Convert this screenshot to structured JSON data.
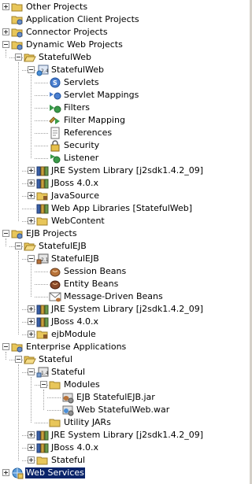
{
  "tree": {
    "items": [
      {
        "label": "Other Projects",
        "depth": 0,
        "icon": "folder-icon",
        "expander": "plus"
      },
      {
        "label": "Application Client Projects",
        "depth": 0,
        "icon": "project-folder-icon",
        "expander": "none"
      },
      {
        "label": "Connector Projects",
        "depth": 0,
        "icon": "project-folder-icon",
        "expander": "plus"
      },
      {
        "label": "Dynamic Web Projects",
        "depth": 0,
        "icon": "project-folder-icon",
        "expander": "minus"
      },
      {
        "label": "StatefulWeb",
        "depth": 1,
        "icon": "open-folder-icon",
        "expander": "minus"
      },
      {
        "label": "StatefulWeb",
        "depth": 2,
        "icon": "web-module-icon",
        "expander": "minus"
      },
      {
        "label": "Servlets",
        "depth": 3,
        "icon": "servlet-icon",
        "expander": "none"
      },
      {
        "label": "Servlet Mappings",
        "depth": 3,
        "icon": "servlet-mapping-icon",
        "expander": "none"
      },
      {
        "label": "Filters",
        "depth": 3,
        "icon": "filter-icon",
        "expander": "none"
      },
      {
        "label": "Filter Mapping",
        "depth": 3,
        "icon": "filter-mapping-icon",
        "expander": "none"
      },
      {
        "label": "References",
        "depth": 3,
        "icon": "references-icon",
        "expander": "none"
      },
      {
        "label": "Security",
        "depth": 3,
        "icon": "security-icon",
        "expander": "none"
      },
      {
        "label": "Listener",
        "depth": 3,
        "icon": "listener-icon",
        "expander": "none"
      },
      {
        "label": "JRE System Library [j2sdk1.4.2_09]",
        "depth": 2,
        "icon": "library-icon",
        "expander": "plus"
      },
      {
        "label": "JBoss 4.0.x",
        "depth": 2,
        "icon": "library-icon",
        "expander": "plus"
      },
      {
        "label": "JavaSource",
        "depth": 2,
        "icon": "source-folder-icon",
        "expander": "plus"
      },
      {
        "label": "Web App Libraries [StatefulWeb]",
        "depth": 2,
        "icon": "library-icon",
        "expander": "none"
      },
      {
        "label": "WebContent",
        "depth": 2,
        "icon": "folder-icon",
        "expander": "plus"
      },
      {
        "label": "EJB Projects",
        "depth": 0,
        "icon": "project-folder-icon",
        "expander": "minus"
      },
      {
        "label": "StatefulEJB",
        "depth": 1,
        "icon": "open-folder-icon",
        "expander": "minus"
      },
      {
        "label": "StatefulEJB",
        "depth": 2,
        "icon": "ejb-module-icon",
        "expander": "minus"
      },
      {
        "label": "Session Beans",
        "depth": 3,
        "icon": "session-bean-icon",
        "expander": "none"
      },
      {
        "label": "Entity Beans",
        "depth": 3,
        "icon": "entity-bean-icon",
        "expander": "none"
      },
      {
        "label": "Message-Driven Beans",
        "depth": 3,
        "icon": "message-driven-bean-icon",
        "expander": "none"
      },
      {
        "label": "JRE System Library [j2sdk1.4.2_09]",
        "depth": 2,
        "icon": "library-icon",
        "expander": "plus"
      },
      {
        "label": "JBoss 4.0.x",
        "depth": 2,
        "icon": "library-icon",
        "expander": "plus"
      },
      {
        "label": "ejbModule",
        "depth": 2,
        "icon": "source-folder-icon",
        "expander": "plus"
      },
      {
        "label": "Enterprise Applications",
        "depth": 0,
        "icon": "project-folder-icon",
        "expander": "minus"
      },
      {
        "label": "Stateful",
        "depth": 1,
        "icon": "open-folder-icon",
        "expander": "minus"
      },
      {
        "label": "Stateful",
        "depth": 2,
        "icon": "ear-module-icon",
        "expander": "minus"
      },
      {
        "label": "Modules",
        "depth": 3,
        "icon": "folder-icon",
        "expander": "minus"
      },
      {
        "label": "EJB StatefulEJB.jar",
        "depth": 4,
        "icon": "ejb-jar-icon",
        "expander": "none"
      },
      {
        "label": "Web StatefulWeb.war",
        "depth": 4,
        "icon": "web-war-icon",
        "expander": "none"
      },
      {
        "label": "Utility JARs",
        "depth": 3,
        "icon": "folder-icon",
        "expander": "none"
      },
      {
        "label": "JRE System Library [j2sdk1.4.2_09]",
        "depth": 2,
        "icon": "library-icon",
        "expander": "plus"
      },
      {
        "label": "JBoss 4.0.x",
        "depth": 2,
        "icon": "library-icon",
        "expander": "plus"
      },
      {
        "label": "Stateful",
        "depth": 2,
        "icon": "folder-icon",
        "expander": "plus"
      },
      {
        "label": "Web Services",
        "depth": 0,
        "icon": "web-services-icon",
        "expander": "plus",
        "selected": true
      }
    ]
  },
  "colors": {
    "selection": "#0a246a",
    "folder": "#e8c65a",
    "project": "#6a8fc4",
    "library": "#c8a03c"
  }
}
